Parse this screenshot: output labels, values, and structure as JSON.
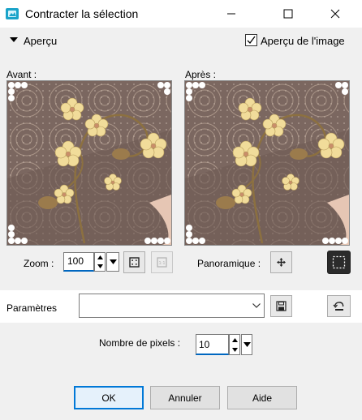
{
  "window": {
    "title": "Contracter la sélection",
    "icons": {
      "app": "paint-app-icon",
      "minimize": "minimize-icon",
      "maximize": "maximize-icon",
      "close": "close-icon"
    }
  },
  "preview": {
    "toggle_label": "Aperçu",
    "image_preview_label": "Aperçu de l'image",
    "image_preview_checked": true,
    "before_label": "Avant :",
    "after_label": "Après :"
  },
  "zoom": {
    "label": "Zoom :",
    "value": "100",
    "icons": {
      "fit": "zoom-fit-icon",
      "actual": "actual-size-icon"
    }
  },
  "pan": {
    "label": "Panoramique :",
    "icon": "move-icon",
    "selection_icon": "selection-marquee-icon"
  },
  "params": {
    "label": "Paramètres",
    "value": "",
    "icons": {
      "save": "save-icon",
      "reset": "reset-icon"
    }
  },
  "pixels": {
    "label": "Nombre de pixels :",
    "value": "10"
  },
  "buttons": {
    "ok": "OK",
    "cancel": "Annuler",
    "help": "Aide"
  },
  "colors": {
    "accent": "#0078d7",
    "pane_bg": "#7d6a62",
    "flower": "#f1dc9a"
  }
}
